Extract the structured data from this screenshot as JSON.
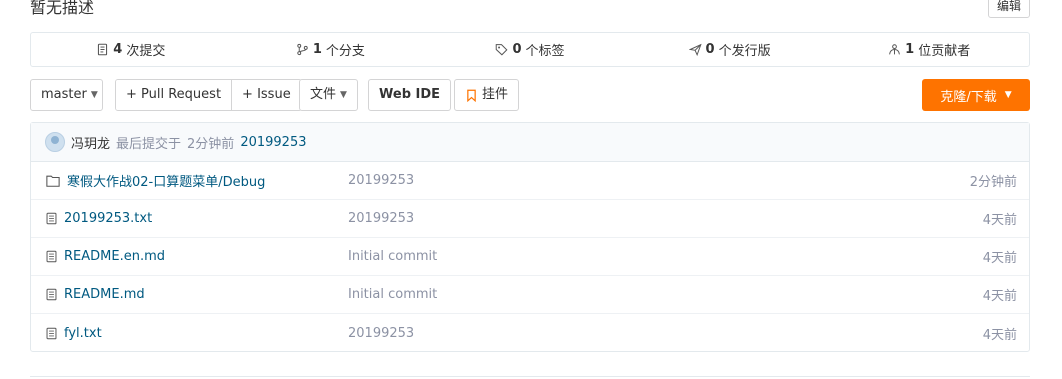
{
  "repo": {
    "description": "暂无描述",
    "edit_label": "编辑"
  },
  "stats": [
    {
      "icon": "commit-icon",
      "count": "4",
      "label": "次提交"
    },
    {
      "icon": "branch-icon",
      "count": "1",
      "label": "个分支"
    },
    {
      "icon": "tag-icon",
      "count": "0",
      "label": "个标签"
    },
    {
      "icon": "release-icon",
      "count": "0",
      "label": "个发行版"
    },
    {
      "icon": "contributors-icon",
      "count": "1",
      "label": "位贡献者"
    }
  ],
  "toolbar": {
    "branch": "master",
    "pull_request": "+ Pull Request",
    "issue": "+ Issue",
    "file": "文件",
    "web_ide": "Web IDE",
    "widget": "挂件",
    "clone": "克隆/下载",
    "accent_color": "#fe7300"
  },
  "last_commit": {
    "author": "冯玥龙",
    "prefix": "最后提交于",
    "time": "2分钟前",
    "message": "20199253"
  },
  "files": [
    {
      "type": "folder",
      "icon": "folder-icon",
      "name": "寒假大作战02-口算题菜单/Debug",
      "message": "20199253",
      "time": "2分钟前"
    },
    {
      "type": "file",
      "icon": "file-icon",
      "name": "20199253.txt",
      "message": "20199253",
      "time": "4天前"
    },
    {
      "type": "file",
      "icon": "file-icon",
      "name": "README.en.md",
      "message": "Initial commit",
      "time": "4天前"
    },
    {
      "type": "file",
      "icon": "file-icon",
      "name": "README.md",
      "message": "Initial commit",
      "time": "4天前"
    },
    {
      "type": "file",
      "icon": "file-icon",
      "name": "fyl.txt",
      "message": "20199253",
      "time": "4天前"
    }
  ]
}
